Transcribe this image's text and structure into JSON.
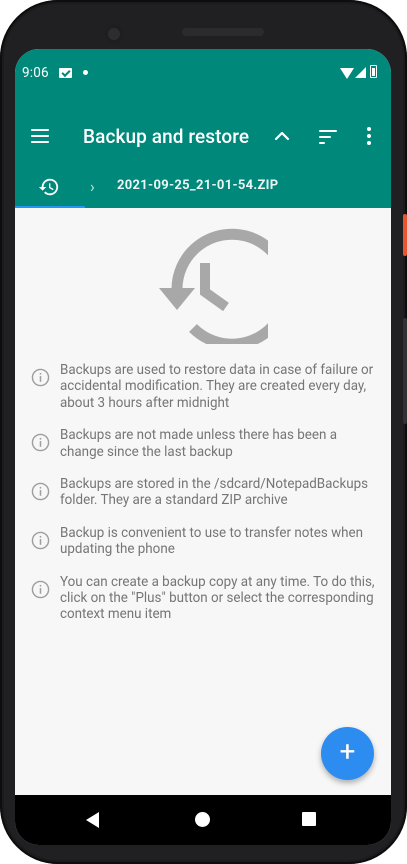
{
  "status_bar": {
    "time": "9:06",
    "icons": [
      "mail-icon",
      "notification-dot",
      "wifi-icon",
      "signal-icon",
      "battery-icon"
    ]
  },
  "toolbar": {
    "title": "Backup and restore",
    "icons": [
      "menu-icon",
      "chevron-up-icon",
      "sort-icon",
      "more-vert-icon"
    ]
  },
  "breadcrumb": {
    "home_icon": "history-icon",
    "separator": "›",
    "file": "2021-09-25_21-01-54.ZIP"
  },
  "info": [
    {
      "icon": "info-icon",
      "text": "Backups are used to restore data in case of failure or accidental modification. They are created every day, about 3 hours after midnight"
    },
    {
      "icon": "info-icon",
      "text": "Backups are not made unless there has been a change since the last backup"
    },
    {
      "icon": "info-icon",
      "text": "Backups are stored in the /sdcard/NotepadBackups folder. They are a standard ZIP archive"
    },
    {
      "icon": "info-icon",
      "text": "Backup is convenient to use to transfer notes when updating the phone"
    },
    {
      "icon": "info-icon",
      "text": "You can create a backup copy at any time. To do this, click on the \"Plus\" button or select the corresponding context menu item"
    }
  ],
  "fab": {
    "label": "+",
    "icon": "add-icon"
  },
  "colors": {
    "primary": "#00897b",
    "accent": "#2d8cf0",
    "tab_indicator": "#2196f3",
    "background": "#f7f7f7",
    "text_secondary": "#757575"
  },
  "nav_bar": [
    "back-icon",
    "home-icon",
    "recents-icon"
  ]
}
